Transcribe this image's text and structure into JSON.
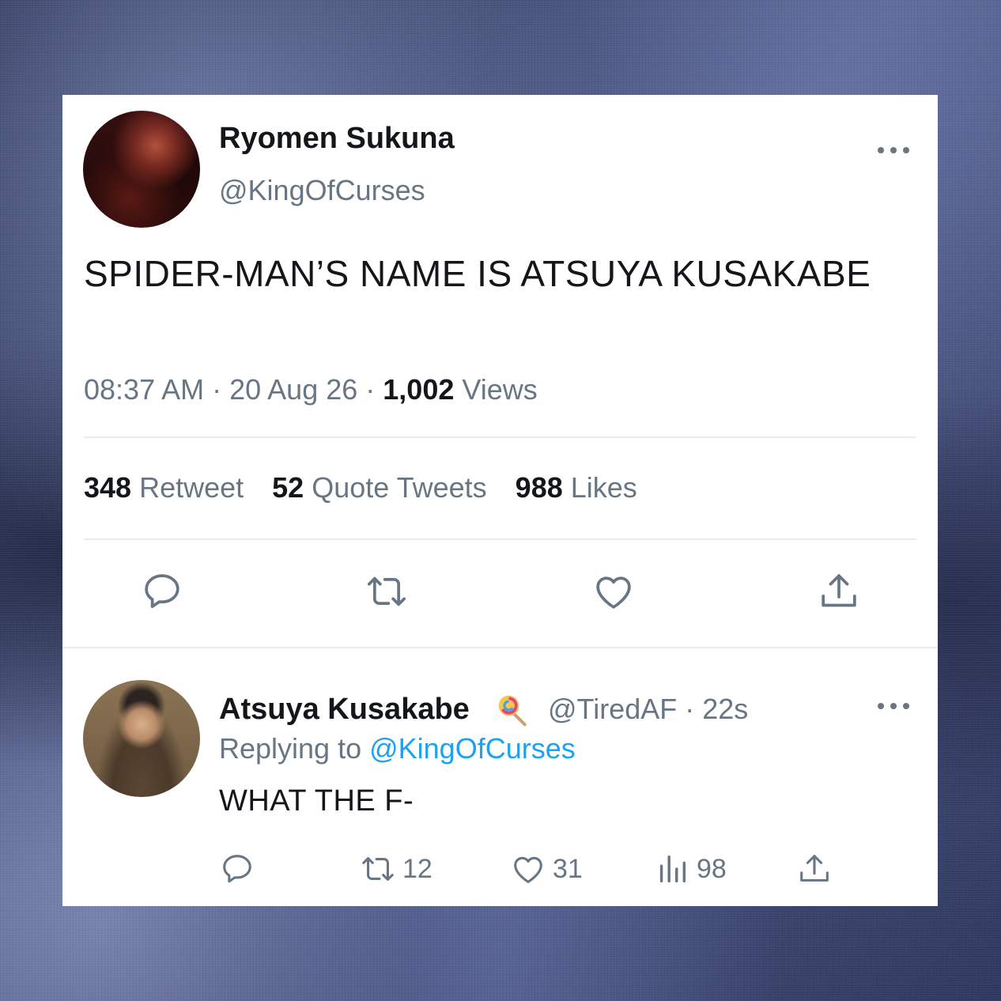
{
  "tweet": {
    "author_name": "Ryomen Sukuna",
    "author_handle": "@KingOfCurses",
    "text": "SPIDER-MAN’S NAME IS ATSUYA KUSAKABE",
    "time": "08:37 AM",
    "sep1": " · ",
    "date": "20 Aug 26",
    "sep2": " · ",
    "views_count": "1,002",
    "views_label": " Views",
    "retweets_count": "348",
    "retweets_label": " Retweet",
    "quotes_count": "52",
    "quotes_label": " Quote Tweets",
    "likes_count": "988",
    "likes_label": " Likes",
    "actions": [
      "reply-icon",
      "retweet-icon",
      "like-icon",
      "share-icon"
    ]
  },
  "reply": {
    "author_name": "Atsuya Kusakabe",
    "badge_icon": "lollipop-icon",
    "handle_time": "@TiredAF · 22s",
    "replying_prefix": "Replying to ",
    "replying_handle": "@KingOfCurses",
    "text": "WHAT THE F-",
    "retweet_count": "12",
    "like_count": "31",
    "views_count": "98"
  },
  "colors": {
    "text_primary": "#14171a",
    "text_secondary": "#687684",
    "link": "#1da1f2",
    "divider": "#e6ecf0",
    "card_bg": "#ffffff"
  }
}
